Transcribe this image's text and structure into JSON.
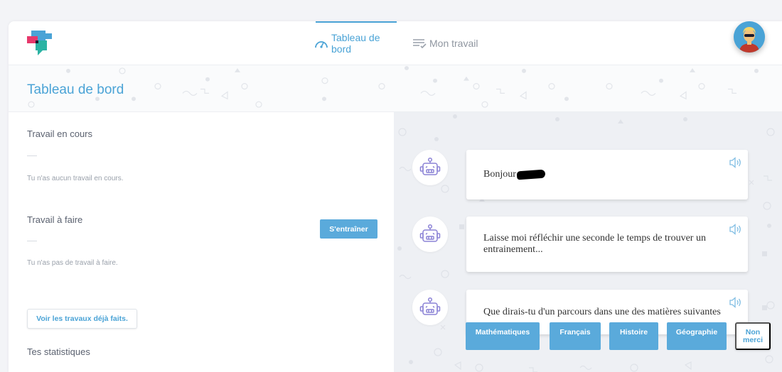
{
  "nav": {
    "dashboard_label": "Tableau de bord",
    "work_label": "Mon travail"
  },
  "header": {
    "title": "Tableau de bord"
  },
  "left": {
    "current_work_title": "Travail en cours",
    "current_work_empty": "Tu n'as aucun travail en cours.",
    "todo_title": "Travail à faire",
    "todo_empty": "Tu n'as pas de travail à faire.",
    "train_button": "S'entraîner",
    "done_button": "Voir les travaux déjà faits.",
    "stats_title": "Tes statistiques"
  },
  "chat": {
    "messages": [
      {
        "text": "Bonjour"
      },
      {
        "text": "Laisse moi réfléchir une seconde le temps de trouver un entrainement..."
      },
      {
        "text": "Que dirais-tu d'un parcours dans une des matières suivantes"
      }
    ],
    "choices": [
      "Mathématiques",
      "Français",
      "Histoire",
      "Géographie"
    ],
    "decline": "Non merci"
  },
  "colors": {
    "accent": "#4aa3d6",
    "button": "#5aaadb",
    "robot": "#8c83d6"
  },
  "icons": {
    "logo": "logo-icon",
    "dashboard": "gauge-icon",
    "work": "list-icon",
    "bot": "robot-icon",
    "speaker": "speaker-icon"
  }
}
